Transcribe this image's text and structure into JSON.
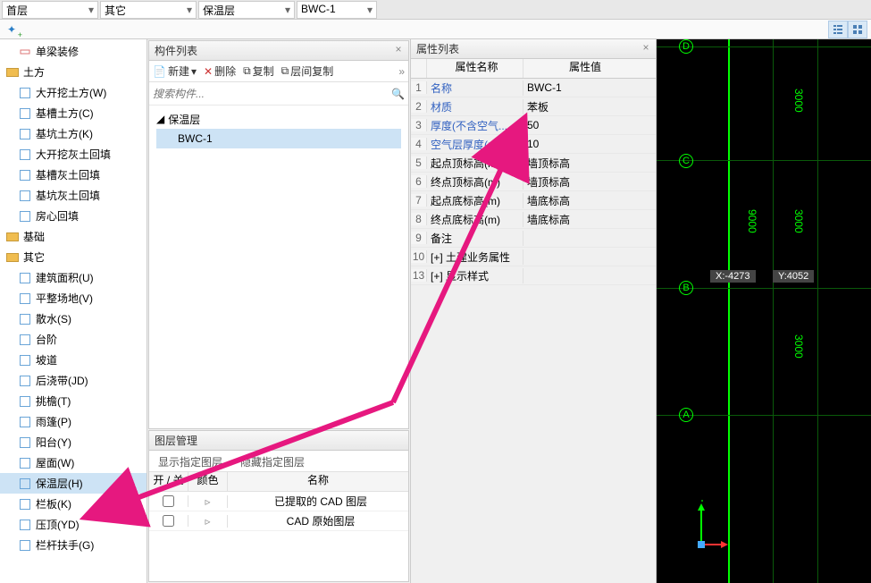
{
  "dropdowns": {
    "floor": "首层",
    "cat": "其它",
    "layer": "保温层",
    "comp": "BWC-1"
  },
  "sidebar": {
    "single": "单梁装修",
    "groups": [
      {
        "label": "土方",
        "items": [
          "大开挖土方(W)",
          "基槽土方(C)",
          "基坑土方(K)",
          "大开挖灰土回填",
          "基槽灰土回填",
          "基坑灰土回填",
          "房心回填"
        ]
      },
      {
        "label": "基础",
        "items": []
      },
      {
        "label": "其它",
        "items": [
          "建筑面积(U)",
          "平整场地(V)",
          "散水(S)",
          "台阶",
          "坡道",
          "后浇带(JD)",
          "挑檐(T)",
          "雨篷(P)",
          "阳台(Y)",
          "屋面(W)",
          "保温层(H)",
          "栏板(K)",
          "压顶(YD)",
          "栏杆扶手(G)"
        ]
      }
    ]
  },
  "compListPanel": {
    "title": "构件列表",
    "toolbar": {
      "new": "新建",
      "del": "删除",
      "copy": "复制",
      "floorCopy": "层间复制"
    },
    "searchPlaceholder": "搜索构件...",
    "tree": {
      "parent": "保温层",
      "child": "BWC-1"
    }
  },
  "layerPanel": {
    "title": "图层管理",
    "tabs": [
      "显示指定图层",
      "隐藏指定图层"
    ],
    "headers": [
      "开 / 关",
      "颜色",
      "名称"
    ],
    "rows": [
      "已提取的 CAD 图层",
      "CAD 原始图层"
    ]
  },
  "propPanel": {
    "title": "属性列表",
    "headerName": "属性名称",
    "headerVal": "属性值",
    "rows": [
      {
        "n": "1",
        "k": "名称",
        "v": "BWC-1",
        "link": true
      },
      {
        "n": "2",
        "k": "材质",
        "v": "苯板",
        "link": true
      },
      {
        "n": "3",
        "k": "厚度(不含空气...",
        "v": "50",
        "link": true
      },
      {
        "n": "4",
        "k": "空气层厚度(mm)",
        "v": "10",
        "link": true
      },
      {
        "n": "5",
        "k": "起点顶标高(m)",
        "v": "墙顶标高",
        "link": false
      },
      {
        "n": "6",
        "k": "终点顶标高(m)",
        "v": "墙顶标高",
        "link": false
      },
      {
        "n": "7",
        "k": "起点底标高(m)",
        "v": "墙底标高",
        "link": false
      },
      {
        "n": "8",
        "k": "终点底标高(m)",
        "v": "墙底标高",
        "link": false
      },
      {
        "n": "9",
        "k": "备注",
        "v": "",
        "link": false
      },
      {
        "n": "10",
        "k": "土建业务属性",
        "v": "",
        "link": false,
        "expand": "+"
      },
      {
        "n": "13",
        "k": "显示样式",
        "v": "",
        "link": false,
        "expand": "+"
      }
    ]
  },
  "canvas": {
    "x": "X:-4273",
    "y": "Y:4052",
    "axes": [
      "A",
      "B",
      "C",
      "D"
    ],
    "dims": [
      "3000",
      "3000",
      "9000",
      "3000"
    ],
    "compassX": "X",
    "compassY": "Y"
  }
}
